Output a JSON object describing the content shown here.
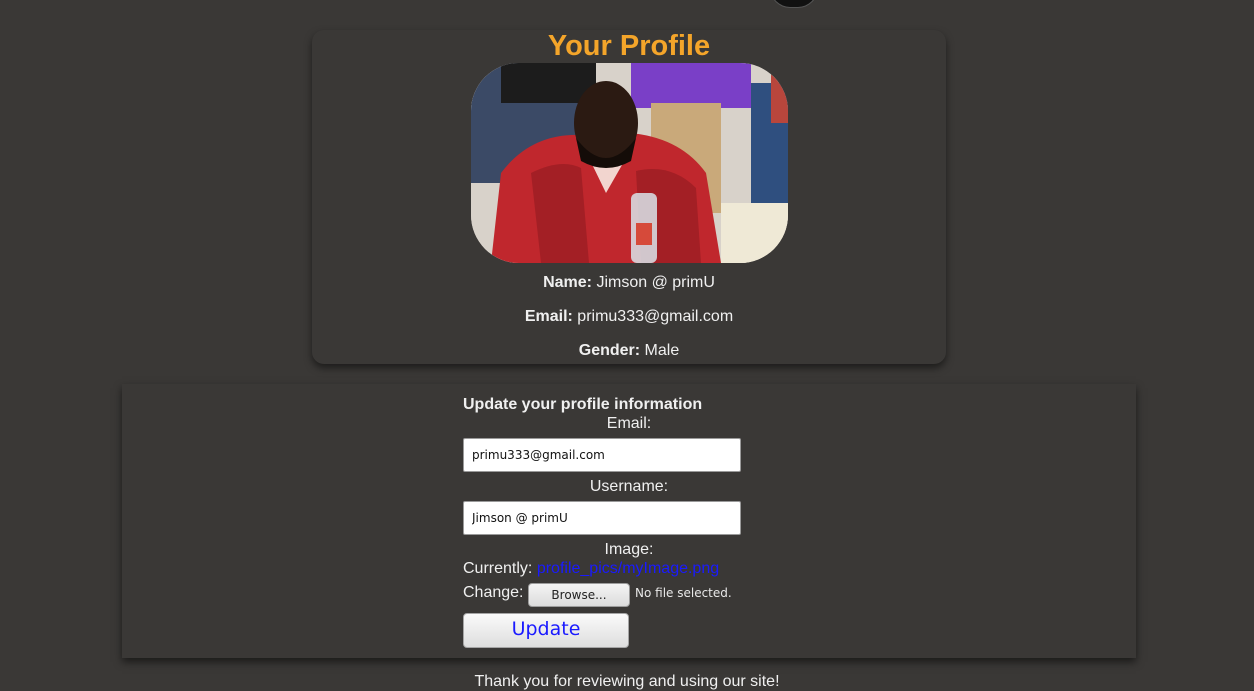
{
  "profile": {
    "title": "Your Profile",
    "name_label": "Name:",
    "name_value": "Jimson @ primU",
    "email_label": "Email:",
    "email_value": "primu333@gmail.com",
    "gender_label": "Gender:",
    "gender_value": "Male"
  },
  "update_form": {
    "heading": "Update your profile information",
    "email_label": "Email:",
    "email_value": "primu333@gmail.com",
    "username_label": "Username:",
    "username_value": "Jimson @ primU",
    "image_label": "Image:",
    "currently_label": "Currently:",
    "current_image_link": "profile_pics/myImage.png",
    "change_label": "Change:",
    "browse_label": "Browse...",
    "no_file_text": "No file selected.",
    "submit_label": "Update"
  },
  "footer": {
    "text": "Thank you for reviewing and using our site!"
  },
  "colors": {
    "background": "#3a3836",
    "title_accent": "#f4a52a",
    "link": "#1a1aff"
  }
}
